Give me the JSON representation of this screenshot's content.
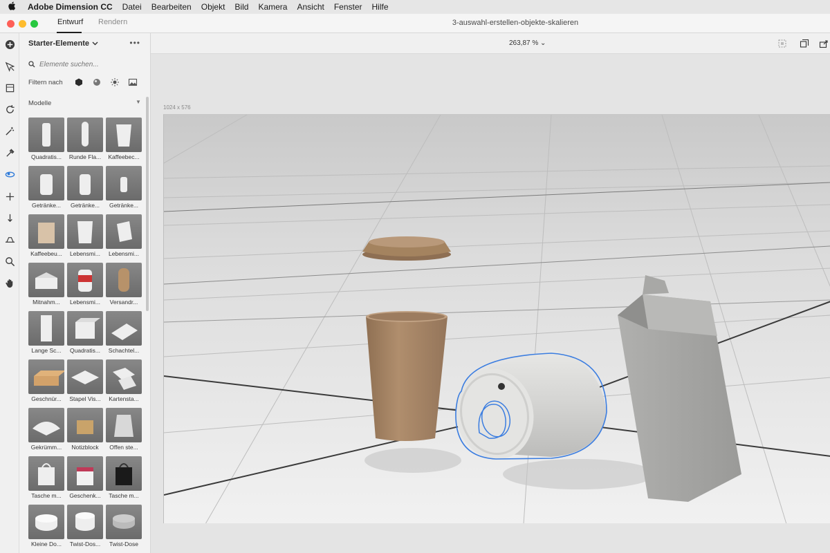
{
  "menubar": {
    "app_name": "Adobe Dimension CC",
    "items": [
      "Datei",
      "Bearbeiten",
      "Objekt",
      "Bild",
      "Kamera",
      "Ansicht",
      "Fenster",
      "Hilfe"
    ]
  },
  "tabs": {
    "design": "Entwurf",
    "render": "Rendern"
  },
  "document_title": "3-auswahl-erstellen-objekte-skalieren",
  "panel": {
    "title": "Starter-Elemente",
    "search_placeholder": "Elemente suchen...",
    "filter_label": "Filtern nach",
    "section": "Modelle",
    "items": [
      {
        "label": "Quadratis..."
      },
      {
        "label": "Runde Fla..."
      },
      {
        "label": "Kaffeebec..."
      },
      {
        "label": "Getränke..."
      },
      {
        "label": "Getränke..."
      },
      {
        "label": "Getränke..."
      },
      {
        "label": "Kaffeebeu..."
      },
      {
        "label": "Lebensmi..."
      },
      {
        "label": "Lebensmi..."
      },
      {
        "label": "Mitnahm..."
      },
      {
        "label": "Lebensmi..."
      },
      {
        "label": "Versandr..."
      },
      {
        "label": "Lange Sc..."
      },
      {
        "label": "Quadratis..."
      },
      {
        "label": "Schachtel..."
      },
      {
        "label": "Geschnür..."
      },
      {
        "label": "Stapel Vis..."
      },
      {
        "label": "Kartensta..."
      },
      {
        "label": "Gekrümm..."
      },
      {
        "label": "Notizblock"
      },
      {
        "label": "Offen ste..."
      },
      {
        "label": "Tasche m..."
      },
      {
        "label": "Geschenk..."
      },
      {
        "label": "Tasche m..."
      },
      {
        "label": "Kleine Do..."
      },
      {
        "label": "Twist-Dos..."
      },
      {
        "label": "Twist-Dose"
      }
    ]
  },
  "canvas": {
    "zoom": "263,87 %",
    "dimensions": "1024 x 576"
  },
  "colors": {
    "kraft": "#a88868",
    "can": "#d9d9d6",
    "selection": "#3b7de0",
    "carton": "#a4a4a2"
  }
}
